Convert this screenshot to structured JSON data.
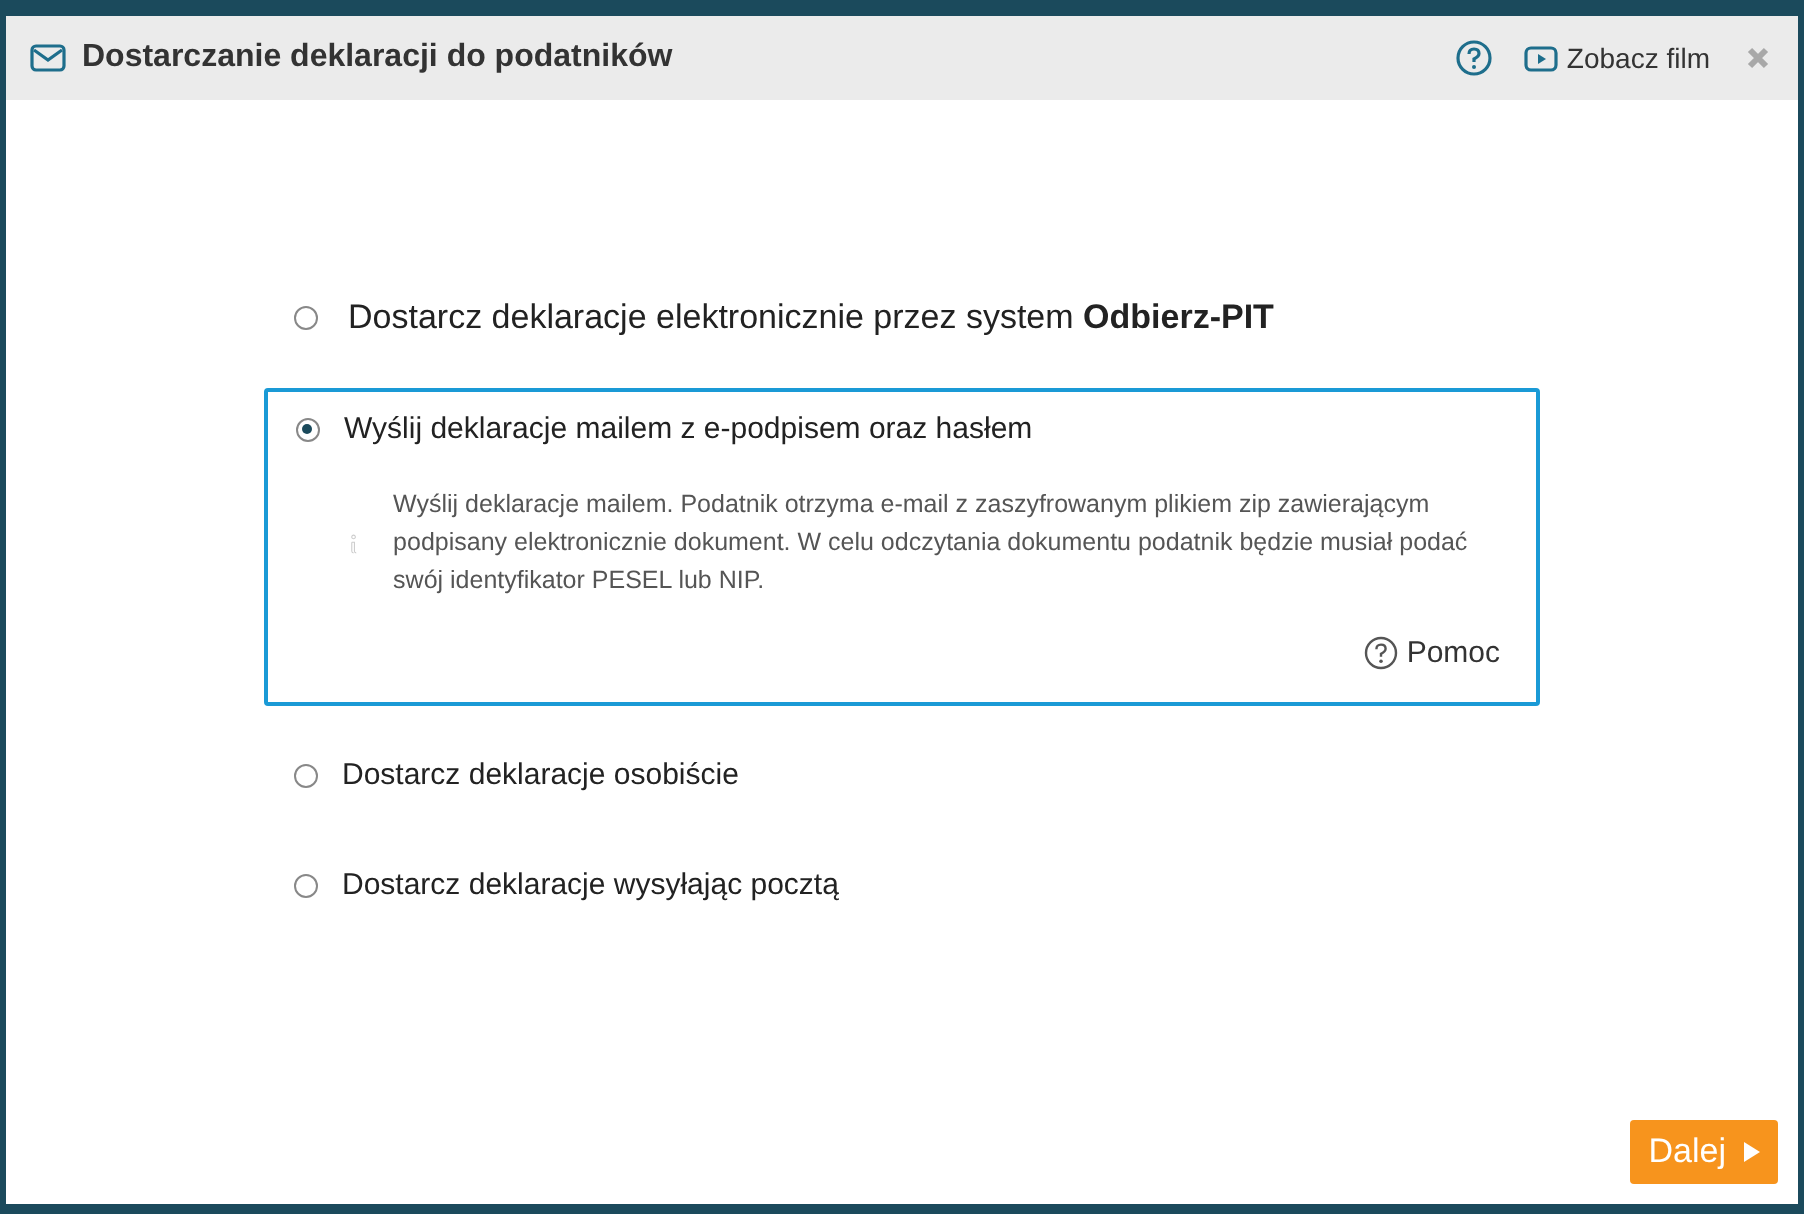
{
  "dialog": {
    "title": "Dostarczanie deklaracji do podatników",
    "video_link": "Zobacz film"
  },
  "options": [
    {
      "label": "Dostarcz deklaracje elektronicznie przez system **Odbierz-PIT**",
      "selected": false
    },
    {
      "label": "Wyślij deklaracje mailem z e-podpisem oraz hasłem",
      "selected": true,
      "description": "Wyślij deklaracje mailem. Podatnik otrzyma e-mail z zaszyfrowanym plikiem zip zawierającym podpisany elektronicznie dokument. W celu odczytania dokumentu podatnik będzie musiał podać swój identyfikator PESEL lub NIP.",
      "help": "Pomoc"
    },
    {
      "label": "Dostarcz deklaracje osobiście",
      "selected": false
    },
    {
      "label": "Dostarcz deklaracje wysyłając pocztą",
      "selected": false
    }
  ],
  "next_button": "Dalej"
}
